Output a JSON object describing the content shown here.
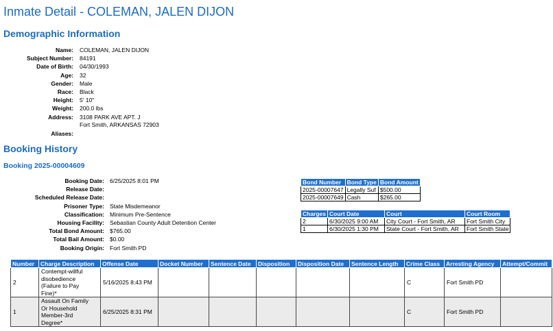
{
  "page": {
    "title": "Inmate Detail - COLEMAN, JALEN DIJON"
  },
  "demographics": {
    "heading": "Demographic Information",
    "fields": [
      {
        "label": "Name:",
        "value": "COLEMAN, JALEN DIJON"
      },
      {
        "label": "Subject Number:",
        "value": "84191"
      },
      {
        "label": "Date of Birth:",
        "value": "04/30/1993"
      },
      {
        "label": "Age:",
        "value": "32"
      },
      {
        "label": "Gender:",
        "value": "Male"
      },
      {
        "label": "Race:",
        "value": "Black"
      },
      {
        "label": "Height:",
        "value": "5' 10\""
      },
      {
        "label": "Weight:",
        "value": "200.0 lbs"
      },
      {
        "label": "Address:",
        "value": "3108 PARK AVE APT. J",
        "value2": "Fort Smith, ARKANSAS 72903"
      },
      {
        "label": "Aliases:",
        "value": ""
      }
    ]
  },
  "booking_history": {
    "heading": "Booking History",
    "booking_title": "Booking 2025-00004609",
    "fields": [
      {
        "label": "Booking Date:",
        "value": "6/25/2025 8:01 PM"
      },
      {
        "label": "Release Date:",
        "value": ""
      },
      {
        "label": "Scheduled Release Date:",
        "value": ""
      },
      {
        "label": "Prisoner Type:",
        "value": "State Misdemeanor"
      },
      {
        "label": "Classification:",
        "value": "Minimum Pre-Sentence"
      },
      {
        "label": "Housing Facility:",
        "value": "Sebastian County Adult Detention Center"
      },
      {
        "label": "Total Bond Amount:",
        "value": "$765.00"
      },
      {
        "label": "Total Bail Amount:",
        "value": "$0.00"
      },
      {
        "label": "Booking Origin:",
        "value": "Fort Smith PD"
      }
    ]
  },
  "bonds": {
    "headers": [
      "Bond Number",
      "Bond Type",
      "Bond Amount"
    ],
    "rows": [
      [
        "2025-00007647",
        "Legally Suf",
        "$500.00"
      ],
      [
        "2025-00007649",
        "Cash",
        "$265.00"
      ]
    ]
  },
  "courts": {
    "headers": [
      "Charges",
      "Court Date",
      "Court",
      "Court Room"
    ],
    "rows": [
      [
        "2",
        "6/30/2025 9:00 AM",
        "City Court - Fort Smith, AR",
        "Fort Smith City"
      ],
      [
        "1",
        "6/30/2025 1:30 PM",
        "State Court - Fort Smith, AR",
        "Fort Smith State"
      ]
    ]
  },
  "charges": {
    "headers": [
      "Number",
      "Charge Description",
      "Offense Date",
      "Docket Number",
      "Sentence Date",
      "Disposition",
      "Disposition Date",
      "Sentence Length",
      "Crime Class",
      "Arresting Agency",
      "Attempt/Commit"
    ],
    "rows": [
      {
        "number": "2",
        "desc": [
          "Contempt-willful",
          "disobedience",
          "(Failure to Pay",
          "Fine)*"
        ],
        "offense_date": "5/16/2025 8:43 PM",
        "docket": "",
        "sentence_date": "",
        "disposition": "",
        "disposition_date": "",
        "sentence_length": "",
        "crime_class": "C",
        "agency": "Fort Smith PD",
        "attempt": ""
      },
      {
        "number": "1",
        "desc": [
          "Assault On Family",
          "Or Household",
          "Member-3rd",
          "Degree*"
        ],
        "offense_date": "6/25/2025 8:31 PM",
        "docket": "",
        "sentence_date": "",
        "disposition": "",
        "disposition_date": "",
        "sentence_length": "",
        "crime_class": "C",
        "agency": "Fort Smith PD",
        "attempt": ""
      }
    ]
  }
}
